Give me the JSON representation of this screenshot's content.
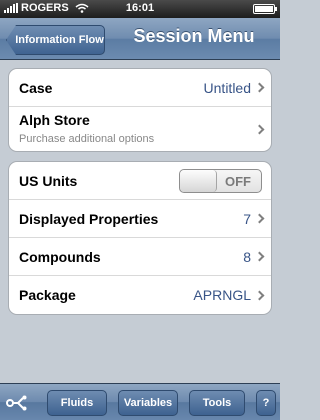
{
  "status": {
    "carrier": "ROGERS",
    "time": "16:01"
  },
  "nav": {
    "back_label": "Information Flow",
    "title": "Session Menu"
  },
  "group1": [
    {
      "label": "Case",
      "value": "Untitled"
    },
    {
      "label": "Alph Store",
      "subtitle": "Purchase additional options"
    }
  ],
  "group2": {
    "us_units": {
      "label": "US Units",
      "state": "OFF"
    },
    "rows": [
      {
        "label": "Displayed Properties",
        "value": "7"
      },
      {
        "label": "Compounds",
        "value": "8"
      },
      {
        "label": "Package",
        "value": "APRNGL"
      }
    ]
  },
  "toolbar": {
    "fluids": "Fluids",
    "variables": "Variables",
    "tools": "Tools",
    "help": "?"
  },
  "colors": {
    "nav": "#6f8caf",
    "background": "#c5ccd4",
    "value_text": "#385487"
  }
}
